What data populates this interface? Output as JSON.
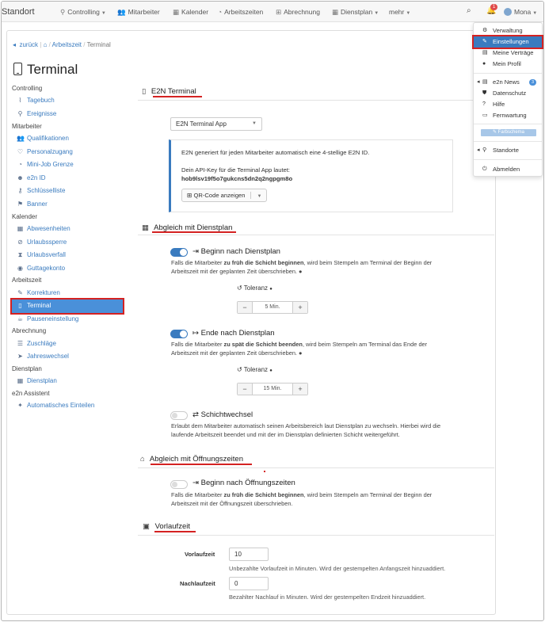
{
  "topbar": {
    "brand": "Standort",
    "nav": [
      "Controlling",
      "Mitarbeiter",
      "Kalender",
      "Arbeitszeiten",
      "Abrechnung",
      "Dienstplan",
      "mehr"
    ],
    "notification_count": "1",
    "user": "Mona"
  },
  "breadcrumb": {
    "back": "zurück",
    "items": [
      "Arbeitszeit",
      "Terminal"
    ]
  },
  "page_title": "Terminal",
  "sidebar": [
    {
      "type": "section",
      "label": "Controlling"
    },
    {
      "type": "item",
      "label": "Tagebuch",
      "icon": "chart-icon"
    },
    {
      "type": "item",
      "label": "Ereignisse",
      "icon": "pin-icon"
    },
    {
      "type": "section",
      "label": "Mitarbeiter"
    },
    {
      "type": "item",
      "label": "Qualifikationen",
      "icon": "users-icon"
    },
    {
      "type": "item",
      "label": "Personalzugang",
      "icon": "handshake-icon"
    },
    {
      "type": "item",
      "label": "Mini-Job Grenze",
      "icon": "gauge-icon"
    },
    {
      "type": "item",
      "label": "e2n ID",
      "icon": "user-id-icon"
    },
    {
      "type": "item",
      "label": "Schlüsselliste",
      "icon": "key-icon"
    },
    {
      "type": "item",
      "label": "Banner",
      "icon": "flag-icon"
    },
    {
      "type": "section",
      "label": "Kalender"
    },
    {
      "type": "item",
      "label": "Abwesenheiten",
      "icon": "calendar-icon"
    },
    {
      "type": "item",
      "label": "Urlaubssperre",
      "icon": "block-icon"
    },
    {
      "type": "item",
      "label": "Urlaubsverfall",
      "icon": "hourglass-icon"
    },
    {
      "type": "item",
      "label": "Guttagekonto",
      "icon": "piggy-icon"
    },
    {
      "type": "section",
      "label": "Arbeitszeit"
    },
    {
      "type": "item",
      "label": "Korrekturen",
      "icon": "user-edit-icon"
    },
    {
      "type": "item",
      "label": "Terminal",
      "icon": "tablet-icon",
      "active": true
    },
    {
      "type": "item",
      "label": "Pauseneinstellung",
      "icon": "coffee-icon"
    },
    {
      "type": "section",
      "label": "Abrechnung"
    },
    {
      "type": "item",
      "label": "Zuschläge",
      "icon": "list-icon"
    },
    {
      "type": "item",
      "label": "Jahreswechsel",
      "icon": "rocket-icon"
    },
    {
      "type": "section",
      "label": "Dienstplan"
    },
    {
      "type": "item",
      "label": "Dienstplan",
      "icon": "calendar-icon"
    },
    {
      "type": "section",
      "label": "e2n Assistent"
    },
    {
      "type": "item",
      "label": "Automatisches Einteilen",
      "icon": "sparkle-icon"
    }
  ],
  "e2n_terminal": {
    "title": "E2N Terminal",
    "select_value": "E2N Terminal App",
    "info_line1": "E2N generiert für jeden Mitarbeiter automatisch eine 4-stellige E2N ID.",
    "info_line2": "Dein API-Key für die Terminal App lautet:",
    "api_key": "hob9lsv19f5o7gukcns5dn2q2ngpgm8o",
    "qr_button": "QR-Code anzeigen"
  },
  "abgleich_dienstplan": {
    "title": "Abgleich mit Dienstplan",
    "beginn": {
      "label": "Beginn nach Dienstplan",
      "enabled": true,
      "desc_pre": "Falls die Mitarbeiter ",
      "desc_bold": "zu früh die Schicht beginnen",
      "desc_post": ", wird beim Stempeln am Terminal der Beginn der",
      "desc_line2": "Arbeitszeit mit der geplanten Zeit überschrieben.",
      "tolerance_label": "Toleranz",
      "tolerance_value": "5 Min."
    },
    "ende": {
      "label": "Ende nach Dienstplan",
      "enabled": true,
      "desc_pre": "Falls die Mitarbeiter ",
      "desc_bold": "zu spät die Schicht beenden",
      "desc_post": ", wird beim Stempeln am Terminal das Ende der",
      "desc_line2": "Arbeitszeit mit der geplanten Zeit überschrieben.",
      "tolerance_label": "Toleranz",
      "tolerance_value": "15 Min."
    },
    "schichtwechsel": {
      "label": "Schichtwechsel",
      "enabled": false,
      "desc_line1": "Erlaubt dem Mitarbeiter automatisch seinen Arbeitsbereich laut Dienstplan zu wechseln. Hierbei wird die",
      "desc_line2": "laufende Arbeitszeit beendet und mit der im Dienstplan definierten Schicht weitergeführt."
    }
  },
  "abgleich_oeffnungszeiten": {
    "title": "Abgleich mit Öffnungszeiten",
    "beginn": {
      "label": "Beginn nach Öffnungszeiten",
      "enabled": false,
      "desc_pre": "Falls die Mitarbeiter ",
      "desc_bold": "zu früh die Schicht beginnen",
      "desc_post": ", wird beim Stempeln am Terminal der Beginn der",
      "desc_line2": "Arbeitszeit mit der Öffnungszeit überschrieben."
    }
  },
  "vorlaufzeit": {
    "title": "Vorlaufzeit",
    "vorlauf_label": "Vorlaufzeit",
    "vorlauf_value": "10",
    "vorlauf_help": "Unbezahlte Vorlaufzeit in Minuten. Wird der gestempelten Anfangszeit hinzuaddiert.",
    "nachlauf_label": "Nachlaufzeit",
    "nachlauf_value": "0",
    "nachlauf_help": "Bezahlter Nachlauf in Minuten. Wird der gestempelten Endzeit hinzuaddiert."
  },
  "user_menu": {
    "items": [
      "Verwaltung",
      "Einstellungen",
      "Meine Verträge",
      "Mein Profil"
    ],
    "news": "e2n News",
    "news_badge": "3",
    "items2": [
      "Datenschutz",
      "Hilfe",
      "Fernwartung"
    ],
    "farbschema": "Farbschema",
    "standorte": "Standorte",
    "abmelden": "Abmelden"
  },
  "colors": {
    "accent": "#3a7bbf",
    "highlight": "#d42222",
    "active_bg": "#4a90d9"
  }
}
